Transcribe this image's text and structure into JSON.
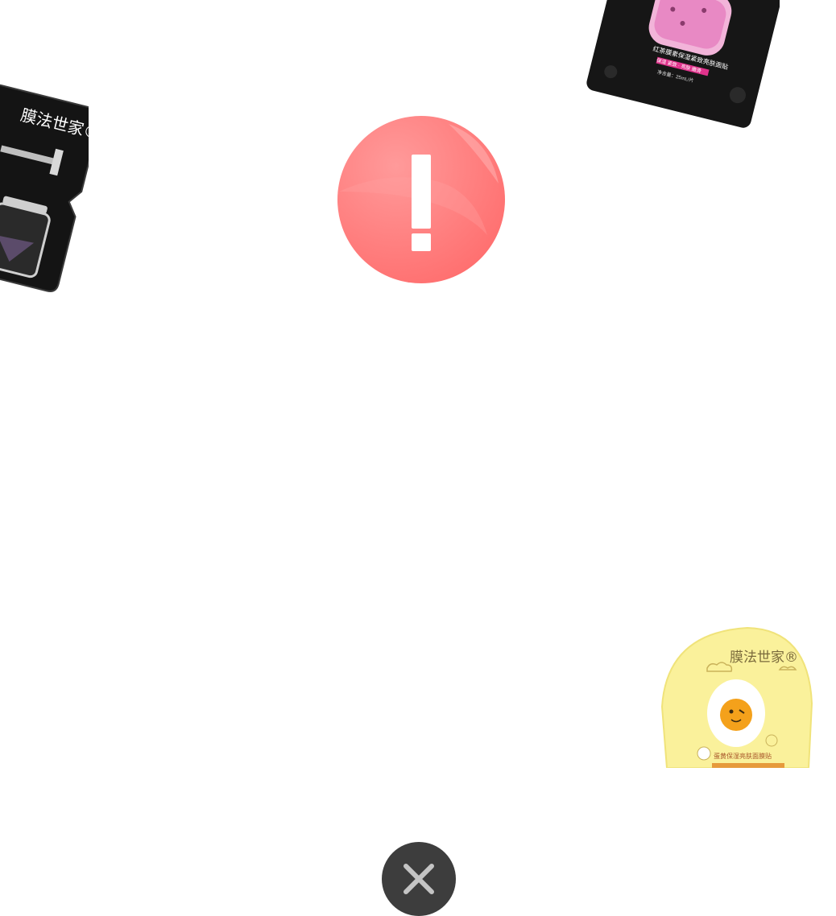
{
  "products": {
    "left": {
      "brand": "膜法世家®"
    },
    "top_right": {
      "name": "红茶膜素保湿紧致亮肤面贴",
      "tags": "保湿 紧致 · 亮肤 嫩滑",
      "net": "净含量：25mL/片"
    },
    "bottom_right": {
      "brand": "膜法世家®",
      "name": "蛋黄保湿亮肤面膜贴"
    }
  },
  "alert": {
    "icon": "exclamation-icon",
    "color": "#ff7b7b"
  },
  "close": {
    "icon": "close-icon",
    "color": "#3d3d3d"
  }
}
